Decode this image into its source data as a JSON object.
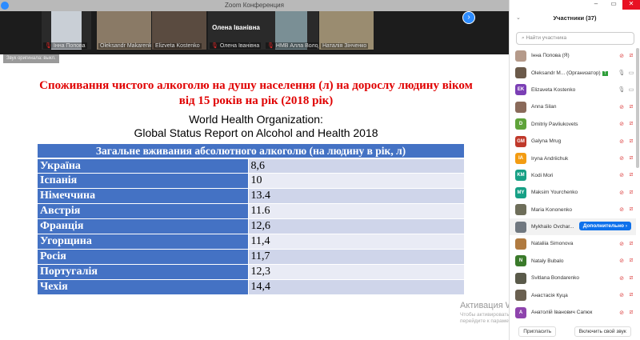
{
  "window": {
    "title": "Zoom Конференция"
  },
  "videos": [
    {
      "name": "Інна Попова",
      "muted": true,
      "photo": "#c9cfd6"
    },
    {
      "name": "Oleksandr Makarenko",
      "muted": false,
      "photo": "#8a7a66"
    },
    {
      "name": "Elizveta Kostenko",
      "muted": false,
      "photo": "#5a4b40"
    },
    {
      "name": "Олена Іванівна",
      "muted": true,
      "display": "Олена Іванівна"
    },
    {
      "name": "НМВ Алла Володимир...",
      "muted": true,
      "photo": "#7a8f95"
    },
    {
      "name": "Наталія Зінченко",
      "muted": false,
      "photo": "#9a8c70"
    }
  ],
  "audio_button": "Звук оригинала: выкл.",
  "slide": {
    "title": "Споживання чистого алкоголю на душу населення (л) на дорослу людину віком від 15 років на рік (2018 рік)",
    "source1": "World Health Organization:",
    "source2": "Global Status Report on Alcohol and Health 2018",
    "table": {
      "header": "Загальне вживания абсолютного алкоголю (на людину в рік, л)",
      "rows": [
        {
          "country": "Україна",
          "value": "8,6"
        },
        {
          "country": "Іспанія",
          "value": "10"
        },
        {
          "country": "Німеччина",
          "value": "13.4"
        },
        {
          "country": "Австрія",
          "value": "11.6"
        },
        {
          "country": "Франція",
          "value": "12,6"
        },
        {
          "country": "Угорщина",
          "value": "11,4"
        },
        {
          "country": "Росія",
          "value": "11,7"
        },
        {
          "country": "Португалія",
          "value": "12,3"
        },
        {
          "country": "Чехія",
          "value": "14,4"
        }
      ]
    }
  },
  "watermark": {
    "title": "Активация Windows",
    "text": "Чтобы активировать Windows, перейдите к параметрам компьютера."
  },
  "participants": {
    "title": "Участники (37)",
    "search_placeholder": "Найти участника",
    "more_button": "Дополнительно ›",
    "list": [
      {
        "name": "Інна Попова (Я)",
        "initials": "",
        "color": "#b59a8a",
        "mic": "muted",
        "cam": "off"
      },
      {
        "name": "Oleksandr M... (Организатор)",
        "initials": "",
        "color": "#6b5a4a",
        "mic": "on",
        "cam": "on",
        "tag": "T"
      },
      {
        "name": "Elizaveta Kostenko",
        "initials": "EK",
        "color": "#7b3fb5",
        "mic": "on",
        "cam": "on"
      },
      {
        "name": "Anna Silan",
        "initials": "",
        "color": "#8a6a5a",
        "mic": "muted",
        "cam": "off"
      },
      {
        "name": "Dmitriy Pavliukovets",
        "initials": "D",
        "color": "#5fa33a",
        "mic": "muted",
        "cam": "off"
      },
      {
        "name": "Galyna Mrug",
        "initials": "GM",
        "color": "#c0392b",
        "mic": "muted",
        "cam": "off"
      },
      {
        "name": "Iryna Andriichuk",
        "initials": "IA",
        "color": "#f39c12",
        "mic": "muted",
        "cam": "off"
      },
      {
        "name": "Kodi Mori",
        "initials": "KM",
        "color": "#16a085",
        "mic": "muted",
        "cam": "off"
      },
      {
        "name": "Maksim Yourchenko",
        "initials": "MY",
        "color": "#16a085",
        "mic": "muted",
        "cam": "off"
      },
      {
        "name": "Maria Kononenko",
        "initials": "",
        "color": "#6e6e5a",
        "mic": "muted",
        "cam": "off"
      },
      {
        "name": "Mykhailo Ovchar...",
        "initials": "",
        "color": "#707880",
        "mic": "",
        "cam": "",
        "more": true
      },
      {
        "name": "Nataliia Simonova",
        "initials": "",
        "color": "#b07a40",
        "mic": "muted",
        "cam": "off"
      },
      {
        "name": "Nataly Bubalo",
        "initials": "N",
        "color": "#3a7a2a",
        "mic": "muted",
        "cam": "off"
      },
      {
        "name": "Svitlana Bondarenko",
        "initials": "",
        "color": "#5a5a4a",
        "mic": "muted",
        "cam": "off"
      },
      {
        "name": "Анастасія Куца",
        "initials": "",
        "color": "#6a6050",
        "mic": "muted",
        "cam": "off"
      },
      {
        "name": "Анатолій Іванович Сапюк",
        "initials": "A",
        "color": "#8e44ad",
        "mic": "muted",
        "cam": "off"
      }
    ],
    "invite_button": "Пригласить",
    "unmute_button": "Включить свой звук"
  }
}
